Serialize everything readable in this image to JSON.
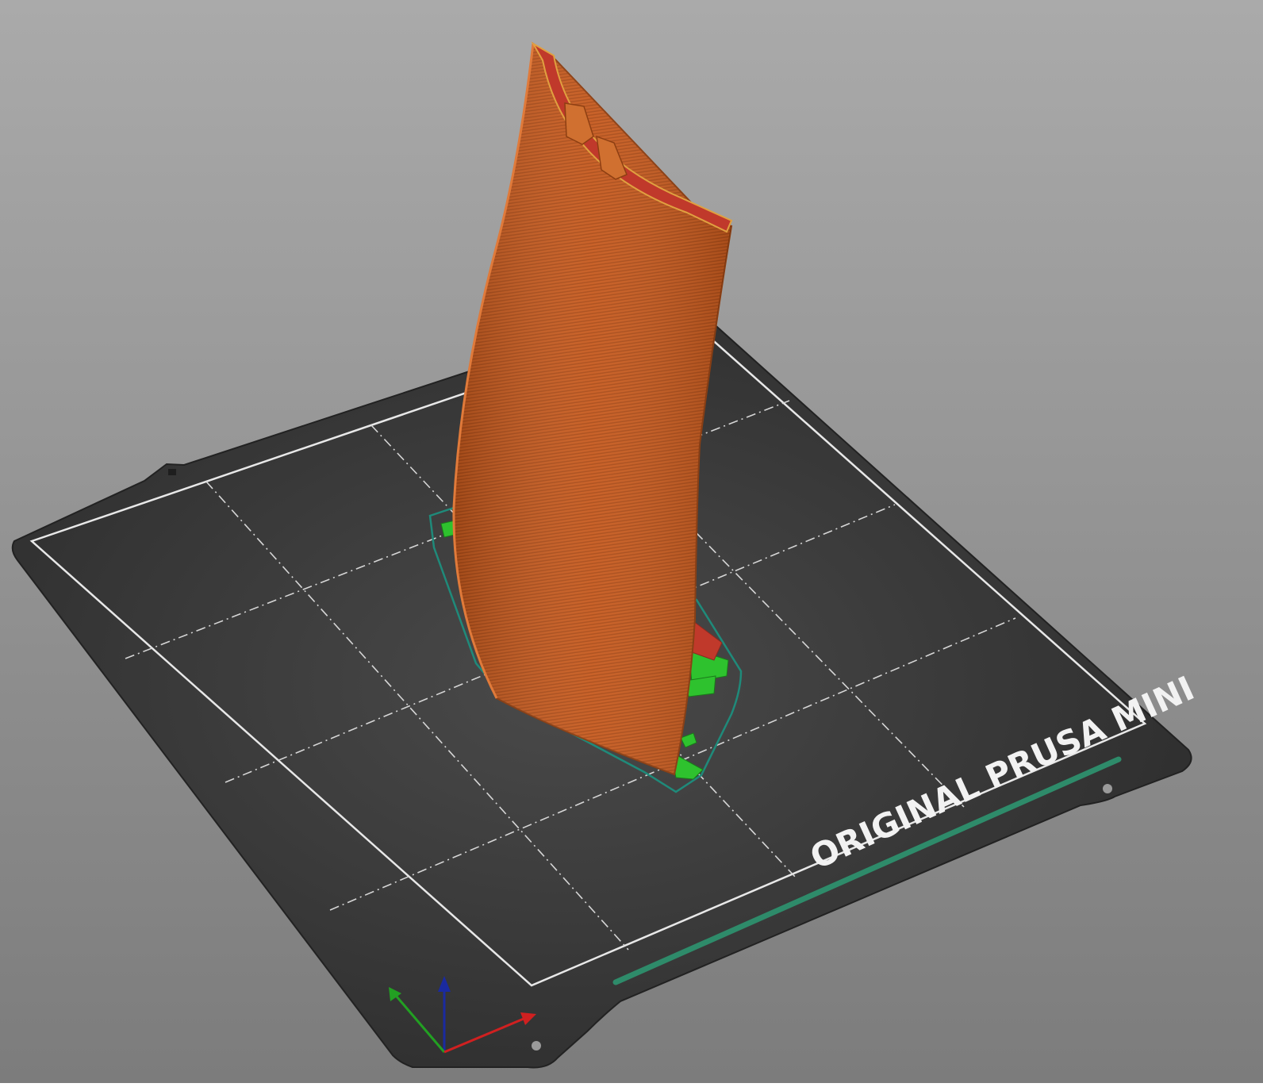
{
  "app": {
    "view": "3D print preview"
  },
  "bed": {
    "label": "ORIGINAL PRUSA MINI",
    "sheet_color": "#3a3a3a",
    "grid_color": "#d8d8d8",
    "label_bar_color": "#2e8b6a"
  },
  "model": {
    "wall_color": "#c95c1f",
    "top_color": "#c0392b",
    "support_color": "#2ec22e",
    "skirt_color": "#1f8a7a"
  },
  "axes": {
    "x_color": "#d02020",
    "y_color": "#22a022",
    "z_color": "#1a2aa0"
  },
  "background": {
    "top": "#a9a9a9",
    "bottom": "#7d7d7d"
  }
}
